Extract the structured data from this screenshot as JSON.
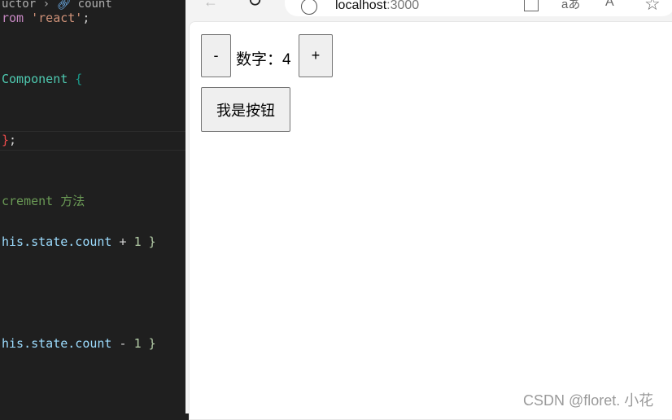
{
  "editor": {
    "breadcrumb": "uctor › ",
    "breadcrumb_symbol": "count",
    "lines": [
      {
        "text": "rom",
        "color": "#c586c0",
        "rest": " 'react'",
        "rest_color": "#ce9178",
        "end": ";"
      },
      {
        "text": "Component",
        "color": "#4ec9b0",
        "rest": " {",
        "rest_color": "#1a9a8a",
        "end": ""
      },
      {
        "text": "}",
        "color": "#f14c4c",
        "rest": "",
        "rest_color": "#d4d4d4",
        "end": ";"
      },
      {
        "text": "crement 方法",
        "color": "#6a9955",
        "rest": "",
        "rest_color": "#6a9955",
        "end": ""
      },
      {
        "text": "his.state.count",
        "color": "#9cdcfe",
        "rest": " + ",
        "rest_color": "#d4d4d4",
        "end": "1 }"
      },
      {
        "text": "his.state.count",
        "color": "#9cdcfe",
        "rest": " - ",
        "rest_color": "#d4d4d4",
        "end": "1 }"
      }
    ]
  },
  "browser": {
    "url_host": "localhost",
    "url_port": ":3000",
    "icons": [
      "back-icon",
      "refresh-icon",
      "info-icon",
      "apps-icon",
      "translate-icon",
      "read-aloud-icon",
      "favorite-icon"
    ]
  },
  "app": {
    "decrement_label": "-",
    "count_label": "数字：",
    "count_value": "4",
    "increment_label": "+",
    "button_label": "我是按钮"
  },
  "watermark": "CSDN @floret. 小花"
}
